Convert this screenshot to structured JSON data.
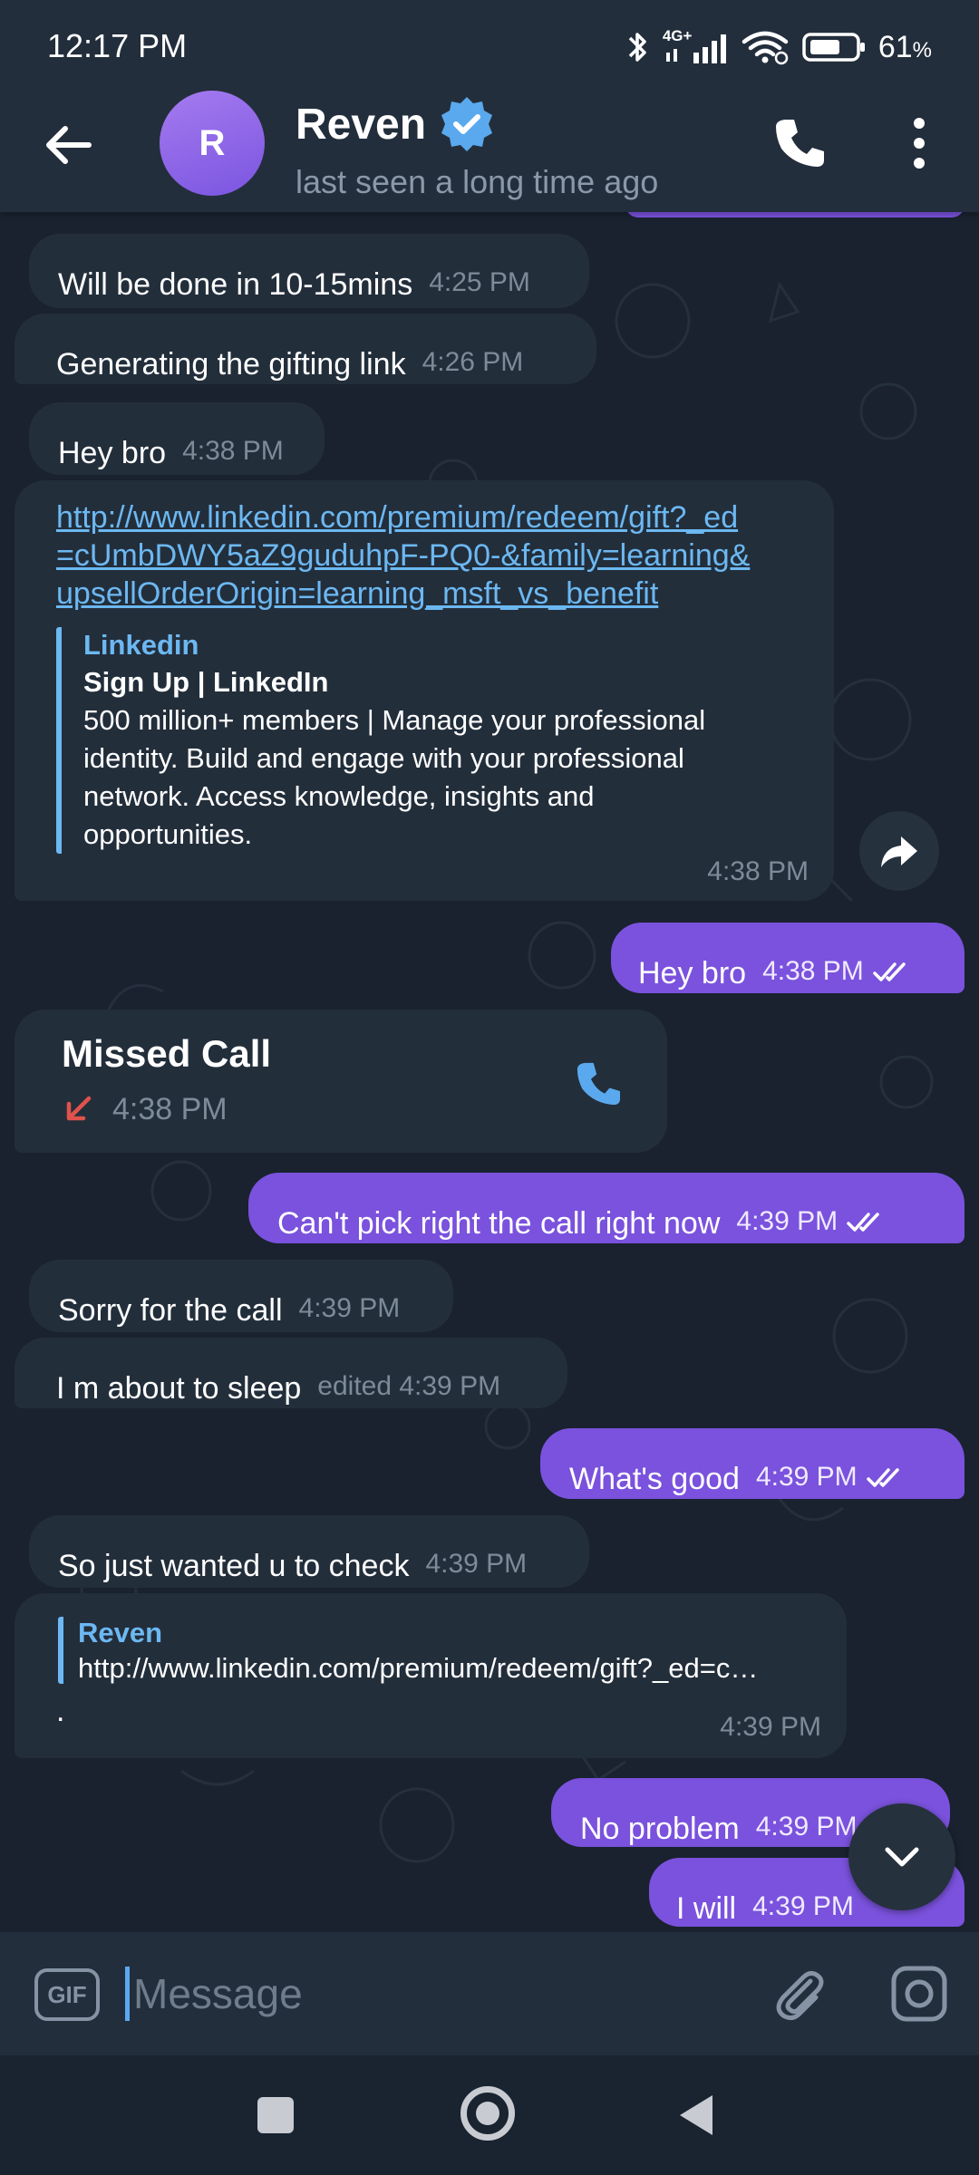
{
  "status_bar": {
    "time": "12:17 PM",
    "network": "4G+",
    "battery_pct": "61",
    "battery_suffix": "%"
  },
  "header": {
    "avatar_initial": "R",
    "contact_name": "Reven",
    "verified": true,
    "last_seen": "last seen a long time ago"
  },
  "messages": [
    {
      "dir": "in",
      "text": "Will be done in 10-15mins",
      "time": "4:25 PM"
    },
    {
      "dir": "in",
      "text": "Generating the  gifting link",
      "time": "4:26 PM"
    },
    {
      "dir": "in",
      "text": "Hey bro",
      "time": "4:38 PM"
    },
    {
      "dir": "in",
      "link_lines": [
        "http://www.linkedin.com/premium/redeem/gift?_ed",
        "=cUmbDWY5aZ9guduhpF-PQ0-&family=learning&",
        "upsellOrderOrigin=learning_msft_vs_benefit"
      ],
      "preview": {
        "site": "Linkedin",
        "title": "Sign Up | LinkedIn",
        "desc_lines": [
          "500 million+ members | Manage your professional",
          "identity. Build and engage with your professional",
          "network. Access knowledge, insights and",
          "opportunities."
        ]
      },
      "time": "4:38 PM"
    },
    {
      "dir": "out",
      "text": "Hey bro",
      "time": "4:38 PM"
    },
    {
      "dir": "in",
      "type": "missed_call",
      "title": "Missed Call",
      "time": "4:38 PM"
    },
    {
      "dir": "out",
      "text": "Can't pick right the call right now",
      "time": "4:39 PM"
    },
    {
      "dir": "in",
      "text": "Sorry for the call",
      "time": "4:39 PM"
    },
    {
      "dir": "in",
      "text": "I m about to sleep",
      "time": "edited 4:39 PM"
    },
    {
      "dir": "out",
      "text": "What's good",
      "time": "4:39 PM"
    },
    {
      "dir": "in",
      "text": "So just wanted u to check",
      "time": "4:39 PM"
    },
    {
      "dir": "in",
      "reply": {
        "author": "Reven",
        "text": "http://www.linkedin.com/premium/redeem/gift?_ed=c…"
      },
      "text": ".",
      "time": "4:39 PM"
    },
    {
      "dir": "out",
      "text": "No problem",
      "time": "4:39 PM"
    },
    {
      "dir": "out",
      "text": "I  will",
      "time": "4:39 PM"
    }
  ],
  "input": {
    "gif_label": "GIF",
    "placeholder": "Message"
  },
  "colors": {
    "header_bg": "#232e3c",
    "chat_bg": "#19222e",
    "incoming_bubble": "#232e3b",
    "outgoing_bubble": "#7a52dd",
    "link": "#6cb8f2",
    "missed_arrow": "#e0524c"
  },
  "icons": {
    "back": "arrow-left-icon",
    "verified": "verified-badge-icon",
    "call": "phone-icon",
    "menu": "more-vertical-icon",
    "share": "share-icon",
    "scroll_down": "chevron-down-icon",
    "attach": "paperclip-icon",
    "camera": "camera-icon"
  }
}
